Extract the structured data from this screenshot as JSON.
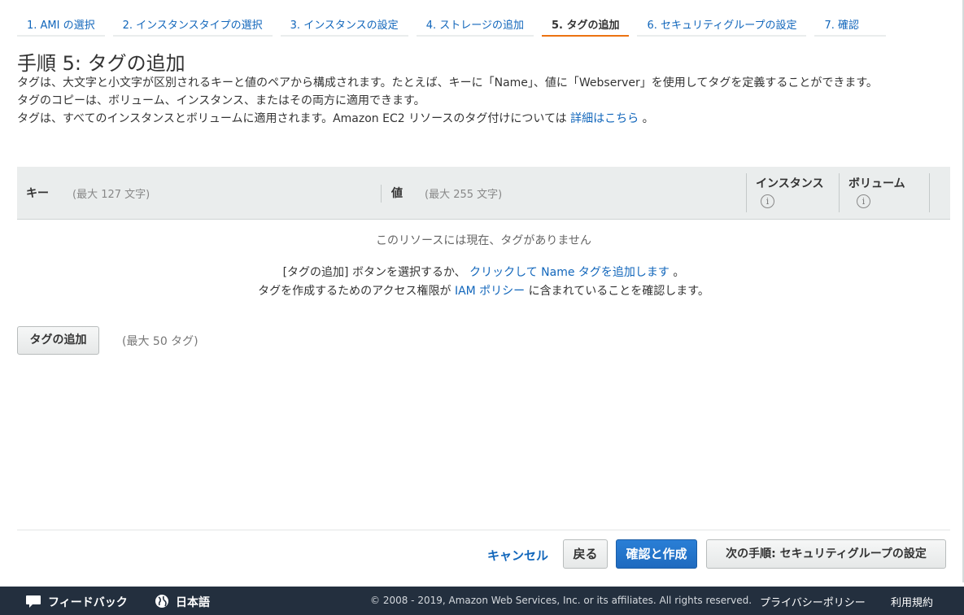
{
  "steps": [
    {
      "label": "1. AMI の選択",
      "active": false
    },
    {
      "label": "2. インスタンスタイプの選択",
      "active": false
    },
    {
      "label": "3. インスタンスの設定",
      "active": false
    },
    {
      "label": "4. ストレージの追加",
      "active": false
    },
    {
      "label": "5. タグの追加",
      "active": true
    },
    {
      "label": "6. セキュリティグループの設定",
      "active": false
    },
    {
      "label": "7. 確認",
      "active": false
    }
  ],
  "page": {
    "title": "手順 5: タグの追加",
    "desc1": "タグは、大文字と小文字が区別されるキーと値のペアから構成されます。たとえば、キーに「Name」、値に「Webserver」を使用してタグを定義することができます。",
    "desc2": "タグのコピーは、ボリューム、インスタンス、またはその両方に適用できます。",
    "desc3_prefix": "タグは、すべてのインスタンスとボリュームに適用されます。Amazon EC2 リソースのタグ付けについては",
    "desc3_link": "詳細はこちら",
    "desc3_suffix": "。"
  },
  "table": {
    "key_label": "キー",
    "key_hint": "(最大 127 文字)",
    "value_label": "値",
    "value_hint": "(最大 255 文字)",
    "instances_label": "インスタンス",
    "volumes_label": "ボリューム",
    "empty_message": "このリソースには現在、タグがありません"
  },
  "hints": {
    "line1_prefix": "[タグの追加] ボタンを選択するか、",
    "line1_link": "クリックして Name タグを追加します",
    "line1_suffix": "。",
    "line2_prefix": "タグを作成するためのアクセス権限が",
    "line2_link": "IAM ポリシー",
    "line2_suffix": "に含まれていることを確認します。"
  },
  "actions": {
    "add_tag": "タグの追加",
    "add_tag_hint": "(最大 50 タグ)",
    "cancel": "キャンセル",
    "back": "戻る",
    "review_launch": "確認と作成",
    "next": "次の手順: セキュリティグループの設定"
  },
  "footer": {
    "feedback": "フィードバック",
    "language": "日本語",
    "copyright": "© 2008 - 2019, Amazon Web Services, Inc. or its affiliates. All rights reserved.",
    "privacy": "プライバシーポリシー",
    "terms": "利用規約"
  },
  "colors": {
    "accent": "#ec7211",
    "link": "#1166bb",
    "primary_button": "#1e6abf",
    "footer_bg": "#232f3e"
  }
}
